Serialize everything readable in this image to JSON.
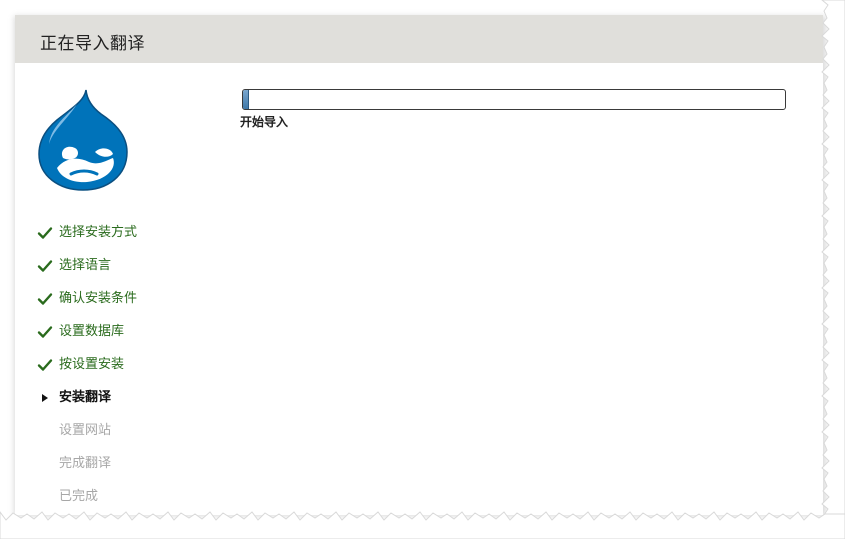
{
  "page": {
    "title": "正在导入翻译"
  },
  "progress": {
    "percent": 1,
    "message": "开始导入"
  },
  "steps": [
    {
      "label": "选择安装方式",
      "state": "done"
    },
    {
      "label": "选择语言",
      "state": "done"
    },
    {
      "label": "确认安装条件",
      "state": "done"
    },
    {
      "label": "设置数据库",
      "state": "done"
    },
    {
      "label": "按设置安装",
      "state": "done"
    },
    {
      "label": "安装翻译",
      "state": "active"
    },
    {
      "label": "设置网站",
      "state": "pending"
    },
    {
      "label": "完成翻译",
      "state": "pending"
    },
    {
      "label": "已完成",
      "state": "pending"
    }
  ],
  "colors": {
    "header_bg": "#e0dfdb",
    "done": "#2a6b1d",
    "pending": "#a7a7a7",
    "logo_blue": "#0073ba",
    "progress_fill": "#3f78a8"
  },
  "icons": {
    "logo": "drupal-drop-logo",
    "done": "checkmark-icon",
    "active": "triangle-right-icon"
  }
}
